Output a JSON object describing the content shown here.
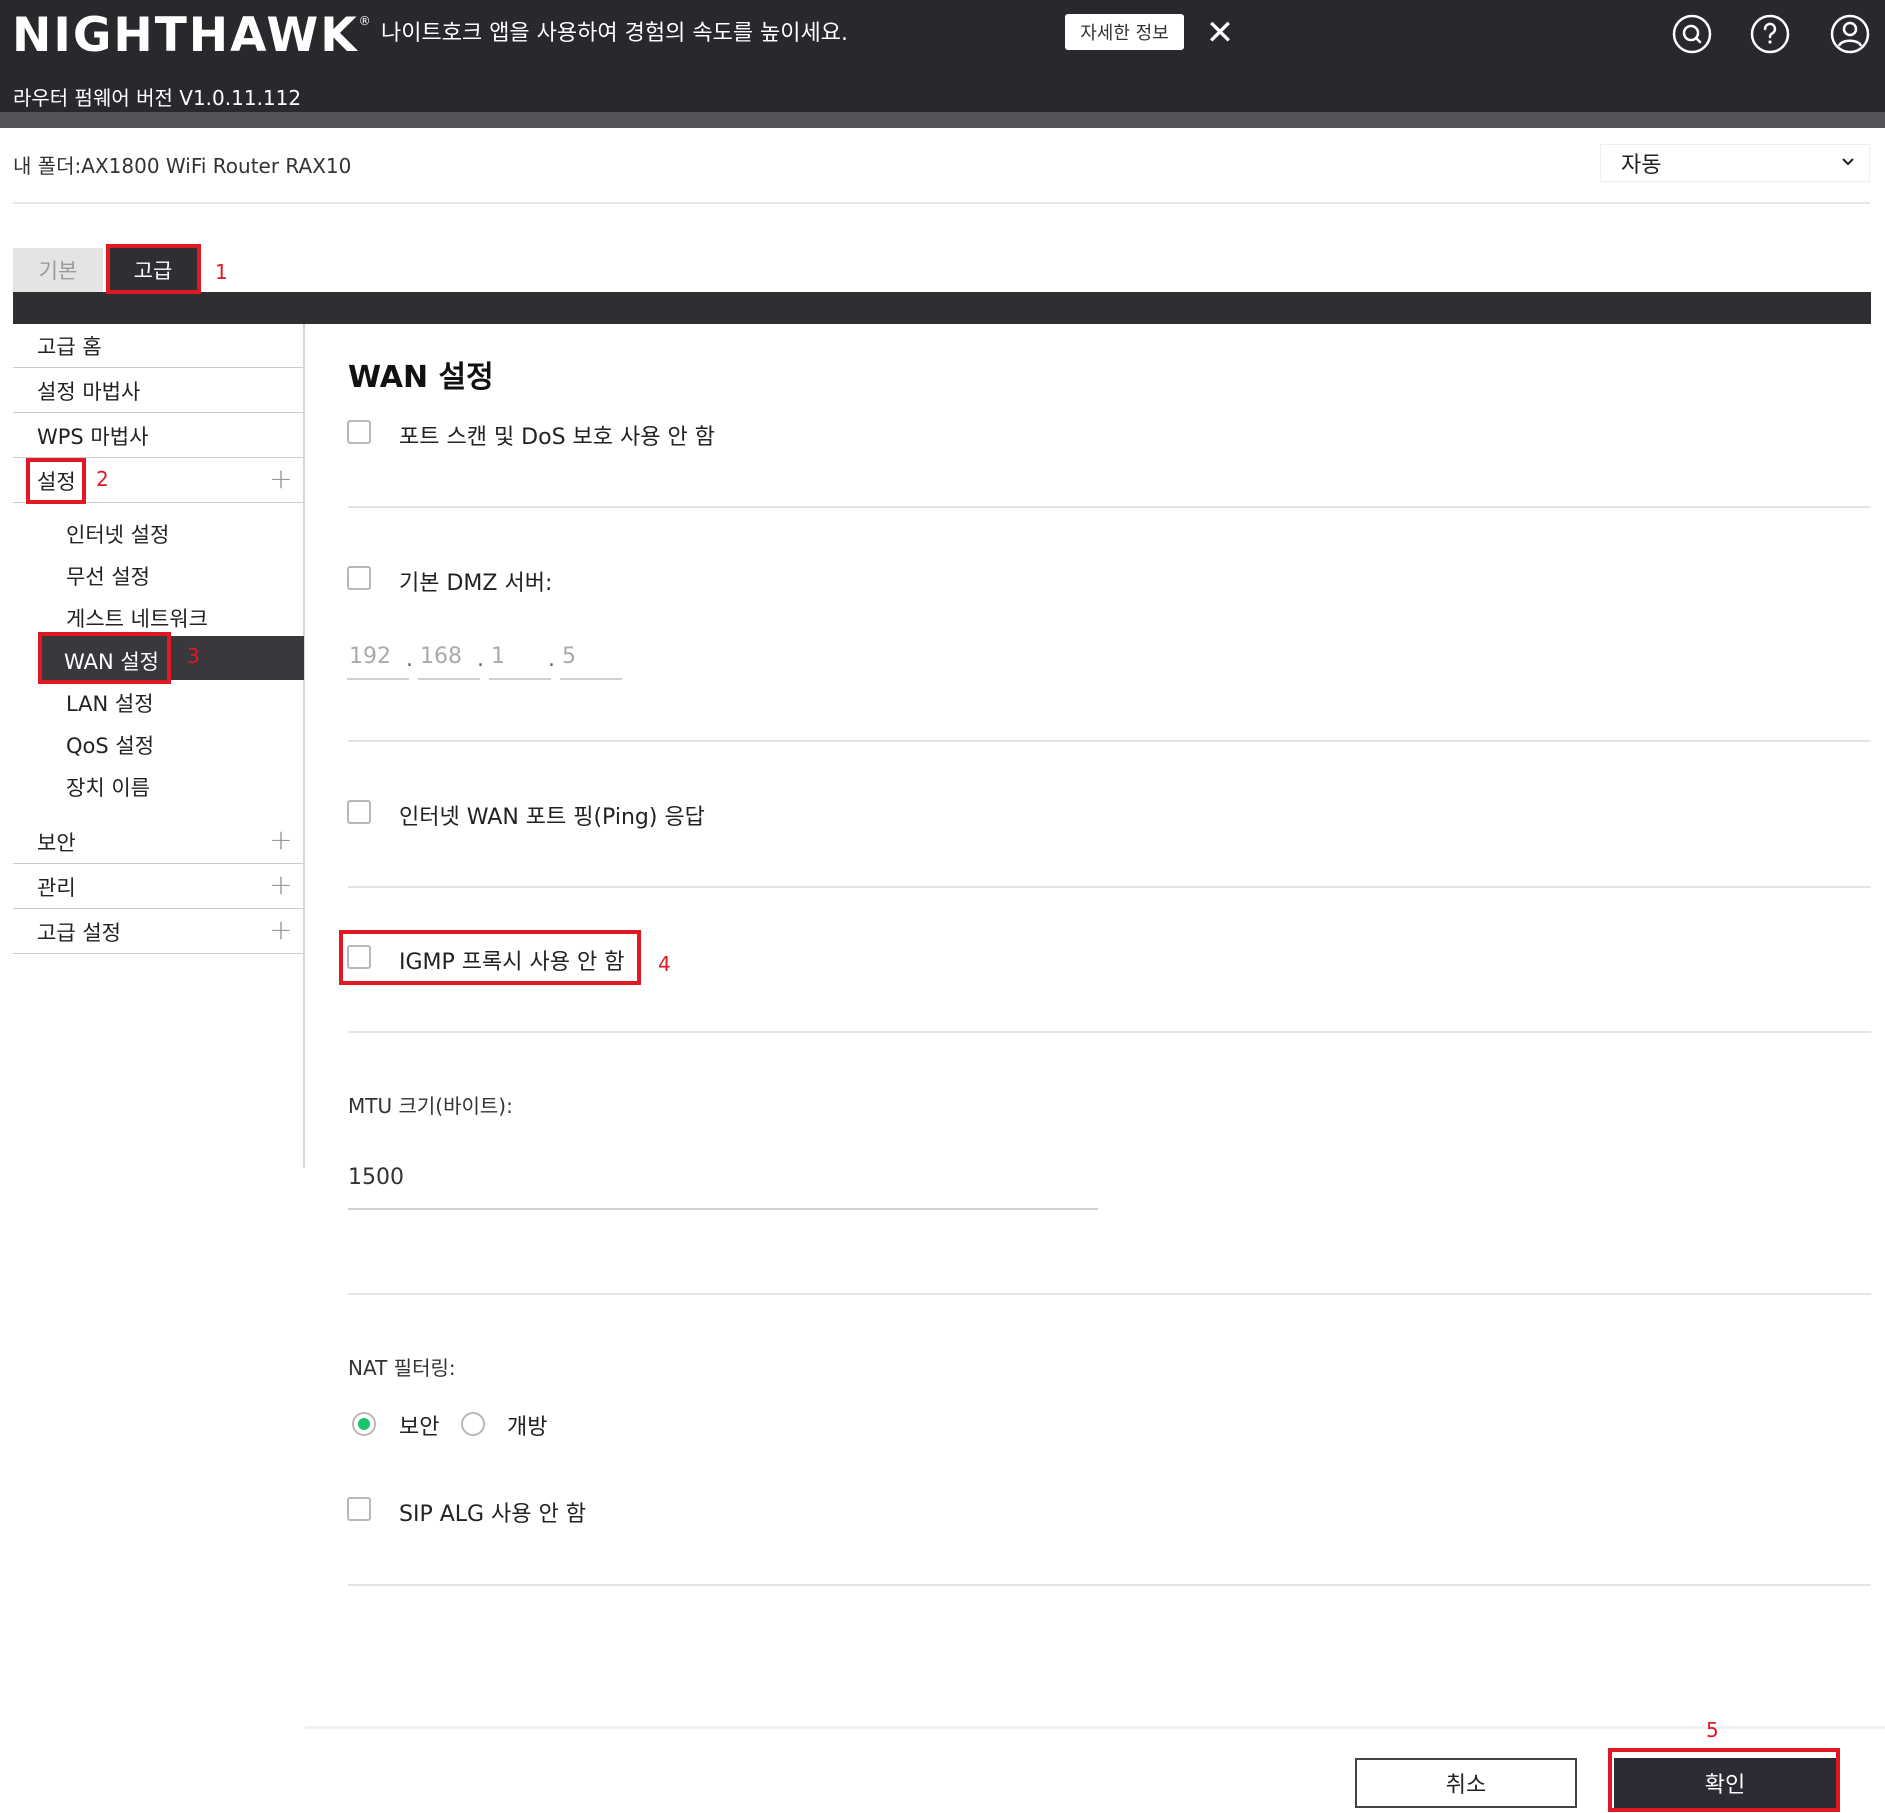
{
  "header": {
    "logo": "NIGHTHAWK",
    "logo_tm": "®",
    "promo_text": "나이트호크 앱을 사용하여 경험의 속도를 높이세요.",
    "promo_button": "자세한 정보",
    "promo_close": "✕",
    "firmware": "라우터 펌웨어 버전 V1.0.11.112",
    "icons": [
      "search-icon",
      "help-icon",
      "user-icon"
    ]
  },
  "breadcrumb": "내 폴더:AX1800 WiFi Router RAX10",
  "language": {
    "selected": "자동"
  },
  "tabs": {
    "basic": "기본",
    "advanced": "고급"
  },
  "annotations": [
    "1",
    "2",
    "3",
    "4",
    "5"
  ],
  "sidebar": {
    "top_items": [
      "고급 홈",
      "설정 마법사",
      "WPS 마법사"
    ],
    "settings": "설정",
    "sub_items": [
      "인터넷 설정",
      "무선 설정",
      "게스트 네트워크",
      "WAN 설정",
      "LAN 설정",
      "QoS 설정",
      "장치 이름"
    ],
    "bottom_items": [
      "보안",
      "관리",
      "고급 설정"
    ],
    "plus": "+"
  },
  "content": {
    "title": "WAN 설정",
    "opt_dos": "포트 스캔 및 DoS 보호 사용 안 함",
    "opt_dmz": "기본 DMZ 서버:",
    "dmz_ip": [
      "192",
      "168",
      "1",
      "5"
    ],
    "ip_dot": ".",
    "opt_ping": "인터넷 WAN 포트 핑(Ping) 응답",
    "opt_igmp": "IGMP 프록시 사용 안 함",
    "mtu_label": "MTU 크기(바이트):",
    "mtu_value": "1500",
    "nat_label": "NAT 필터링:",
    "nat_secure": "보안",
    "nat_open": "개방",
    "nat_selected": "보안",
    "opt_sip": "SIP ALG 사용 안 함"
  },
  "footer": {
    "cancel": "취소",
    "ok": "확인"
  },
  "colors": {
    "header_bg": "#2a272d",
    "annotation": "#e01822",
    "radio_on": "#19c46a",
    "active_nav": "#3a373d"
  }
}
